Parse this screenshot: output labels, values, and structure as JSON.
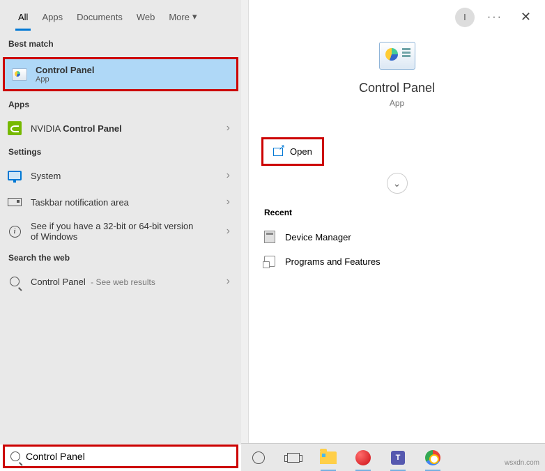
{
  "tabs": {
    "all": "All",
    "apps": "Apps",
    "documents": "Documents",
    "web": "Web",
    "more": "More"
  },
  "avatar_initial": "I",
  "sections": {
    "best": "Best match",
    "apps": "Apps",
    "settings": "Settings",
    "web": "Search the web",
    "recent": "Recent"
  },
  "best": {
    "title": "Control Panel",
    "sub": "App"
  },
  "apps": {
    "nvidia_pre": "NVIDIA ",
    "nvidia_bold": "Control Panel"
  },
  "settings": {
    "system": "System",
    "taskbar": "Taskbar notification area",
    "bits": "See if you have a 32-bit or 64-bit version of Windows"
  },
  "web": {
    "cp": "Control Panel",
    "suffix": " - See web results"
  },
  "detail": {
    "title": "Control Panel",
    "sub": "App",
    "open": "Open"
  },
  "recent": {
    "dm": "Device Manager",
    "pf": "Programs and Features"
  },
  "search_value": "Control Panel",
  "watermark": "wsxdn.com"
}
